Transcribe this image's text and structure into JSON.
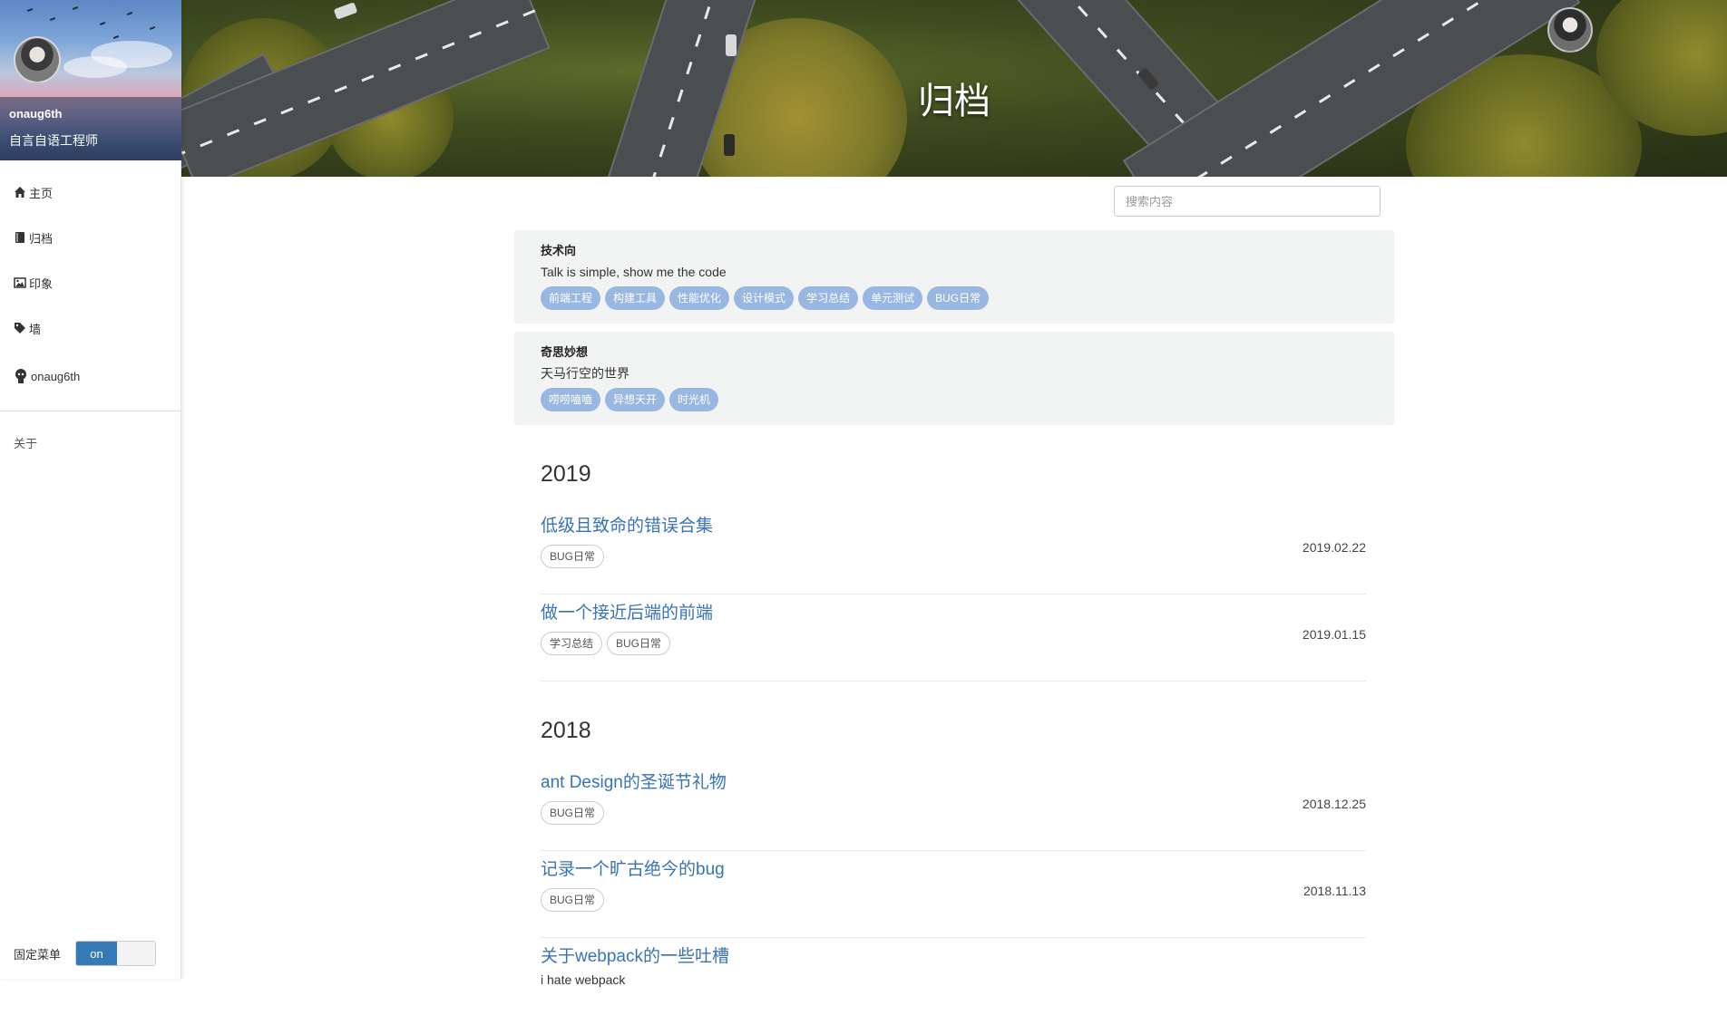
{
  "sidebar": {
    "user_name": "onaug6th",
    "motto": "自言自语工程师",
    "nav": [
      {
        "label": "主页",
        "icon": "home-icon"
      },
      {
        "label": "归档",
        "icon": "book-icon"
      },
      {
        "label": "印象",
        "icon": "picture-icon"
      },
      {
        "label": "墙",
        "icon": "tag-icon"
      },
      {
        "label": "onaug6th",
        "icon": "github-icon"
      }
    ],
    "about": "关于",
    "fix_menu_label": "固定菜单",
    "fix_menu_state": "on"
  },
  "banner": {
    "title": "归档"
  },
  "search": {
    "placeholder": "搜索内容"
  },
  "categories": [
    {
      "title": "技术向",
      "desc": "Talk is simple, show me the code",
      "tags": [
        "前端工程",
        "构建工具",
        "性能优化",
        "设计模式",
        "学习总结",
        "单元测试",
        "BUG日常"
      ]
    },
    {
      "title": "奇思妙想",
      "desc": "天马行空的世界",
      "tags": [
        "唠唠嗑嗑",
        "异想天开",
        "时光机"
      ]
    }
  ],
  "years": [
    {
      "year": "2019",
      "posts": [
        {
          "title": "低级且致命的错误合集",
          "tags": [
            "BUG日常"
          ],
          "date": "2019.02.22"
        },
        {
          "title": "做一个接近后端的前端",
          "tags": [
            "学习总结",
            "BUG日常"
          ],
          "date": "2019.01.15"
        }
      ]
    },
    {
      "year": "2018",
      "posts": [
        {
          "title": "ant Design的圣诞节礼物",
          "tags": [
            "BUG日常"
          ],
          "date": "2018.12.25"
        },
        {
          "title": "记录一个旷古绝今的bug",
          "tags": [
            "BUG日常"
          ],
          "date": "2018.11.13"
        },
        {
          "title": "关于webpack的一些吐槽",
          "desc": "i hate webpack",
          "tags": [],
          "date": ""
        }
      ]
    }
  ],
  "colors": {
    "accent": "#337ab7",
    "link": "#3a73b5",
    "tag_bg": "#98b8e1"
  }
}
